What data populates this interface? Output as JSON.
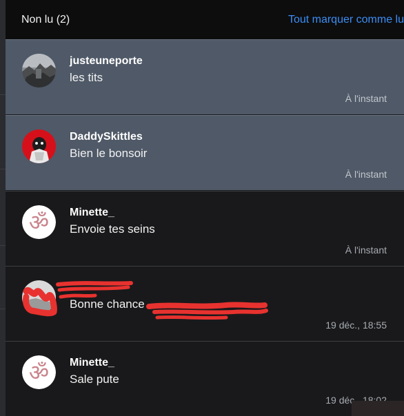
{
  "header": {
    "title": "Non lu (2)",
    "mark_all": "Tout marquer comme lu"
  },
  "notifications": [
    {
      "name": "justeuneporte",
      "message": "les tits",
      "time": "À l'instant",
      "unread": true,
      "avatar": "photo-avatar"
    },
    {
      "name": "DaddySkittles",
      "message": "Bien le bonsoir",
      "time": "À l'instant",
      "unread": true,
      "avatar": "red-avatar"
    },
    {
      "name": "Minette_",
      "message": "Envoie tes seins",
      "time": "À l'instant",
      "unread": false,
      "avatar": "om-icon"
    },
    {
      "name": "",
      "message": "Bonne chance",
      "time": "19 déc., 18:55",
      "unread": false,
      "avatar": "redacted-avatar"
    },
    {
      "name": "Minette_",
      "message": "Sale pute",
      "time": "19 déc., 18:02",
      "unread": false,
      "avatar": "om-icon"
    }
  ],
  "colors": {
    "accent": "#3c8ef5",
    "unread_bg": "#4f5967",
    "redaction": "#e8322f"
  }
}
